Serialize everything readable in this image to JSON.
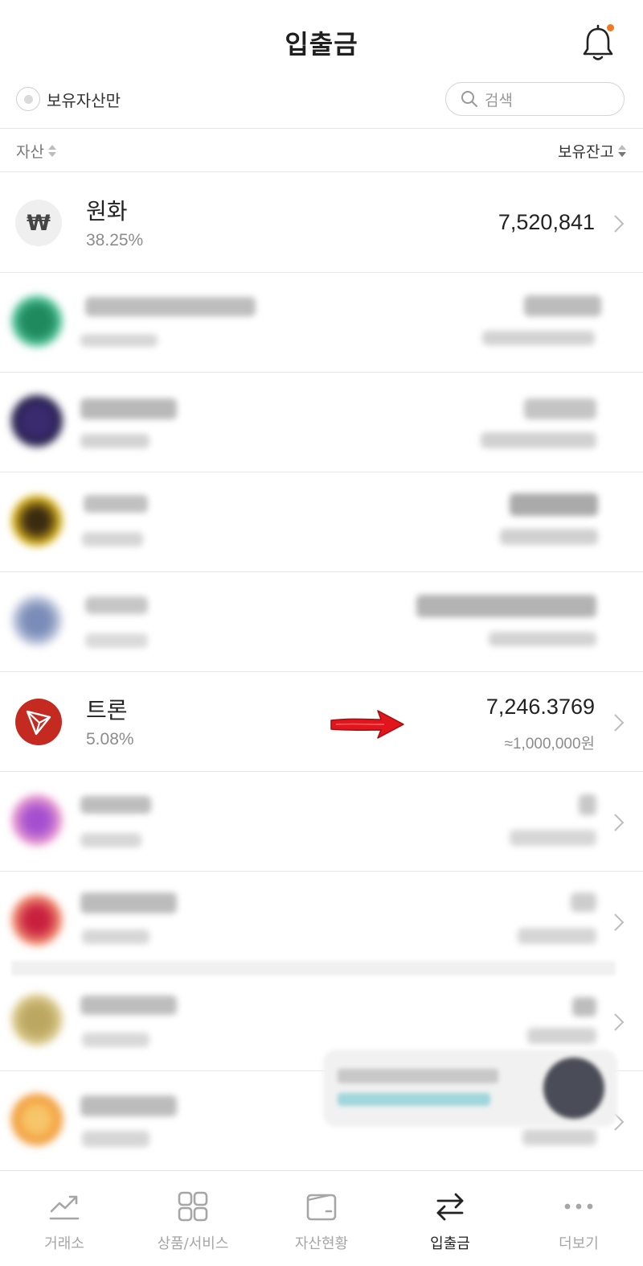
{
  "header": {
    "title": "입출금"
  },
  "filter": {
    "holding_only_label": "보유자산만",
    "search_placeholder": "검색"
  },
  "columns": {
    "asset_label": "자산",
    "balance_label": "보유잔고"
  },
  "assets": {
    "won": {
      "icon": "won-sign",
      "symbol": "₩",
      "name": "원화",
      "percent": "38.25%",
      "balance": "7,520,841"
    },
    "tron": {
      "icon": "tron-icon",
      "name": "트론",
      "percent": "5.08%",
      "balance": "7,246.3769",
      "krw_value": "≈1,000,000원",
      "icon_color": "#c52a21"
    }
  },
  "annotation": {
    "arrow_color": "#e2141c"
  },
  "tabs": [
    {
      "label": "거래소",
      "icon": "chart-trend-icon",
      "active": false
    },
    {
      "label": "상품/서비스",
      "icon": "grid-icon",
      "active": false
    },
    {
      "label": "자산현황",
      "icon": "wallet-icon",
      "active": false
    },
    {
      "label": "입출금",
      "icon": "transfer-icon",
      "active": true
    },
    {
      "label": "더보기",
      "icon": "more-icon",
      "active": false
    }
  ]
}
